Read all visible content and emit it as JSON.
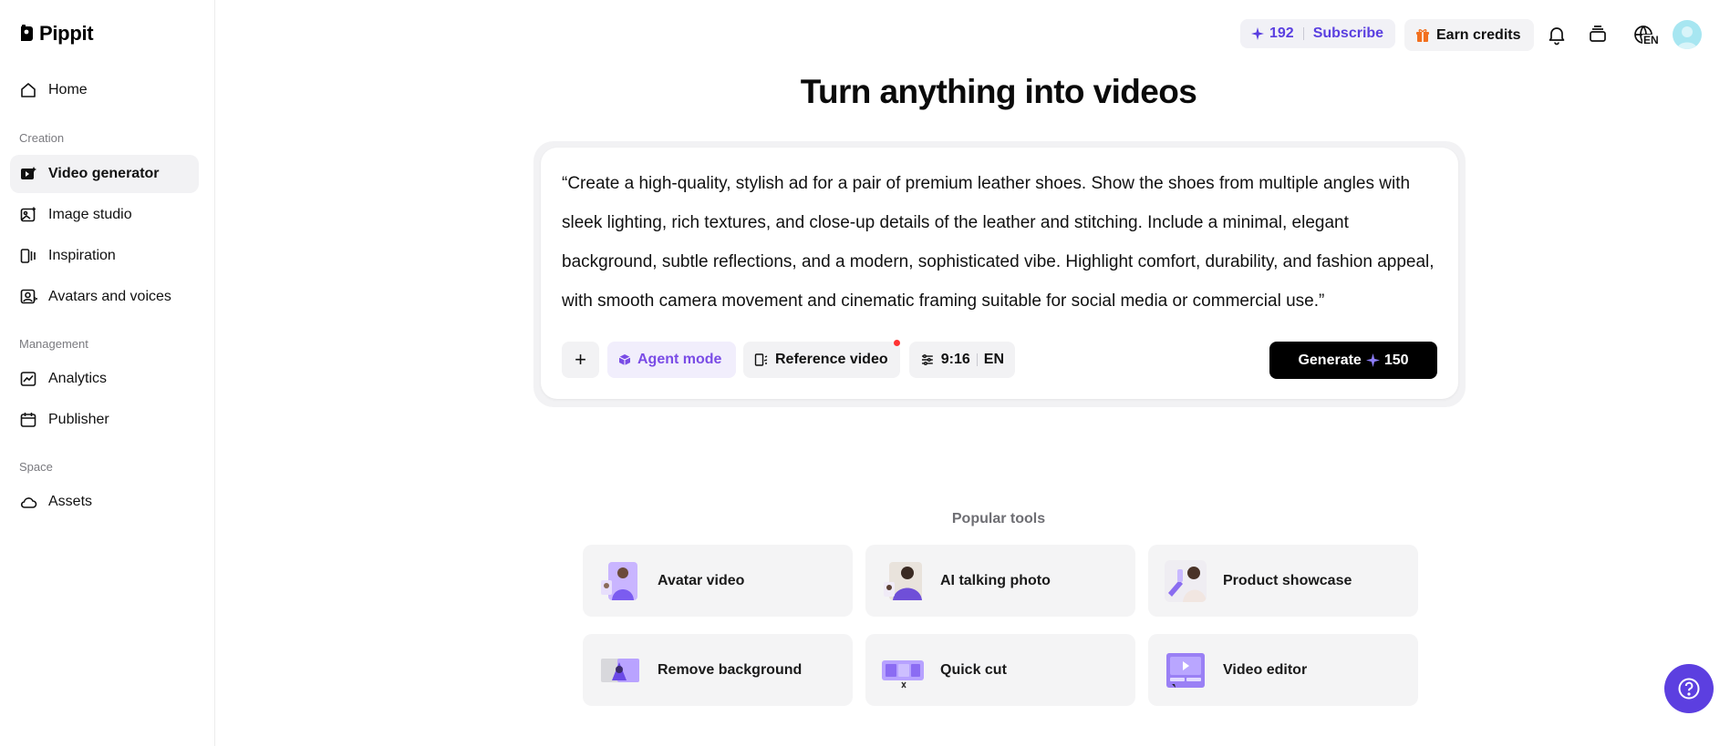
{
  "app": {
    "name": "Pippit"
  },
  "sidebar": {
    "home": "Home",
    "sections": [
      {
        "label": "Creation",
        "items": [
          "Video generator",
          "Image studio",
          "Inspiration",
          "Avatars and voices"
        ]
      },
      {
        "label": "Management",
        "items": [
          "Analytics",
          "Publisher"
        ]
      },
      {
        "label": "Space",
        "items": [
          "Assets"
        ]
      }
    ],
    "active": "Video generator"
  },
  "topbar": {
    "credits": "192",
    "subscribe": "Subscribe",
    "earn_credits": "Earn credits",
    "language": "EN",
    "accent_color": "#5a3fe0"
  },
  "main": {
    "title": "Turn anything into videos",
    "prompt": "“Create a high-quality, stylish ad for a pair of premium leather shoes. Show the shoes from multiple angles with sleek lighting, rich textures, and close-up details of the leather and stitching. Include a minimal, elegant background, subtle reflections, and a modern, sophisticated vibe. Highlight comfort, durability, and fashion appeal, with smooth camera movement and cinematic framing suitable for social media or commercial use.”",
    "controls": {
      "add": "+",
      "agent_mode": "Agent mode",
      "reference_video": "Reference video",
      "ratio": "9:16",
      "language": "EN"
    },
    "generate": {
      "label": "Generate",
      "cost": "150"
    }
  },
  "popular": {
    "label": "Popular tools",
    "tools": [
      "Avatar video",
      "AI talking photo",
      "Product showcase",
      "Remove background",
      "Quick cut",
      "Video editor"
    ]
  },
  "help": {
    "icon": "question-icon"
  }
}
